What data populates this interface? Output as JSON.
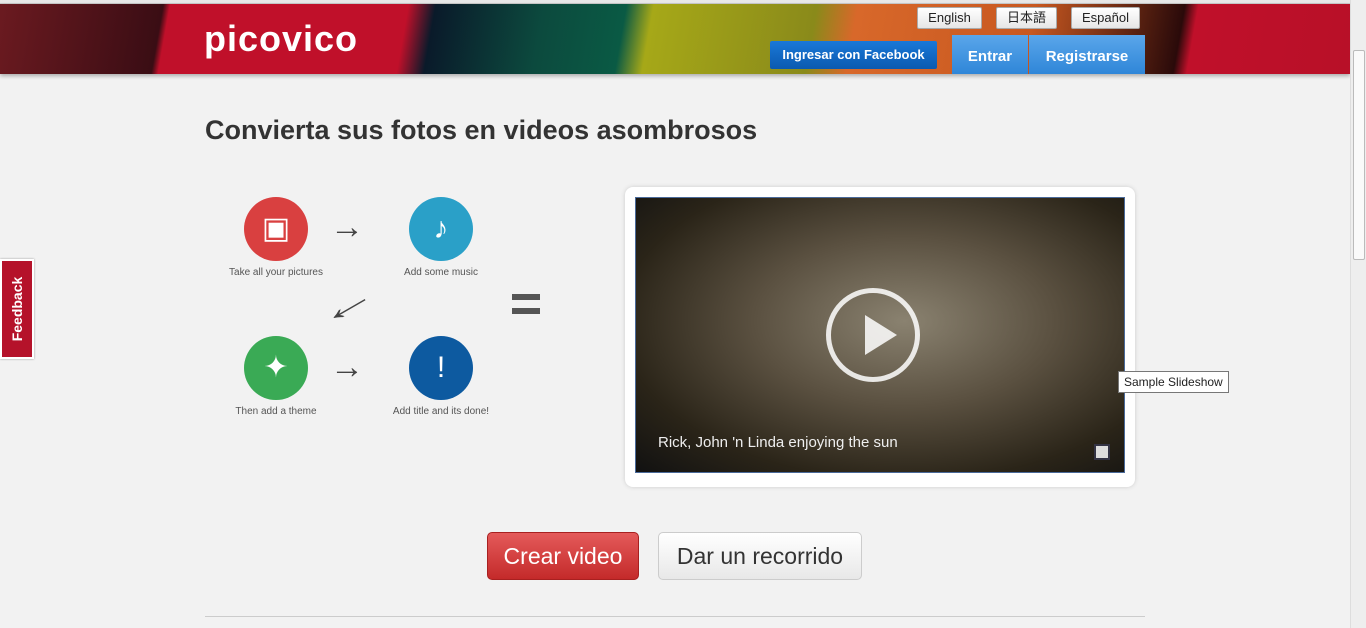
{
  "header": {
    "logo": "picovico",
    "languages": [
      "English",
      "日本語",
      "Español"
    ],
    "facebook_login": "Ingresar con Facebook",
    "login": "Entrar",
    "register": "Registrarse"
  },
  "feedback": "Feedback",
  "main": {
    "title": "Convierta sus fotos en videos asombrosos",
    "steps": [
      {
        "label": "Take all your pictures",
        "icon": "photos-icon",
        "color": "#d94040"
      },
      {
        "label": "Add some music",
        "icon": "music-note-icon",
        "color": "#2aa0c8"
      },
      {
        "label": "Then add a theme",
        "icon": "sparkles-icon",
        "color": "#3aaa55"
      },
      {
        "label": "Add title and its done!",
        "icon": "chat-alert-icon",
        "color": "#0d5aa0"
      }
    ],
    "video": {
      "caption": "Rick, John 'n Linda enjoying  the sun",
      "tooltip": "Sample Slideshow"
    },
    "create_button": "Crear video",
    "tour_button": "Dar un recorrido"
  }
}
